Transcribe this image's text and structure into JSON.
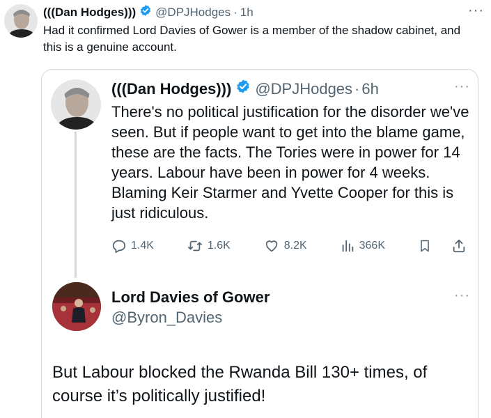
{
  "outer": {
    "name": "(((Dan Hodges)))",
    "handle": "@DPJHodges",
    "separator": "·",
    "time": "1h",
    "text": "Had it confirmed Lord Davies of Gower is a member of the shadow cabinet, and this is a genuine account.",
    "more": "···"
  },
  "quoted": {
    "name": "(((Dan Hodges)))",
    "handle": "@DPJHodges",
    "separator": "·",
    "time": "6h",
    "text": "There's no political justification for the disorder we've seen. But if people want to get into the blame game, these are the facts. The Tories were in power for 14 years. Labour have been in power for 4 weeks. Blaming Keir Starmer and Yvette Cooper for this is just ridiculous.",
    "more": "···",
    "stats": {
      "replies": "1.4K",
      "reposts": "1.6K",
      "likes": "8.2K",
      "views": "366K"
    }
  },
  "reply": {
    "name": "Lord Davies of Gower",
    "handle": "@Byron_Davies",
    "text": "But Labour blocked the Rwanda Bill 130+ times, of course it’s politically justified!",
    "more": "···"
  },
  "icons": {
    "verified": "verified-badge-icon",
    "reply": "reply-icon",
    "repost": "repost-icon",
    "like": "heart-icon",
    "views": "views-icon",
    "bookmark": "bookmark-icon",
    "share": "share-icon"
  },
  "colors": {
    "verified_blue": "#1d9bf0",
    "text": "#0f1419",
    "muted": "#536471",
    "border": "#cfd9de"
  }
}
